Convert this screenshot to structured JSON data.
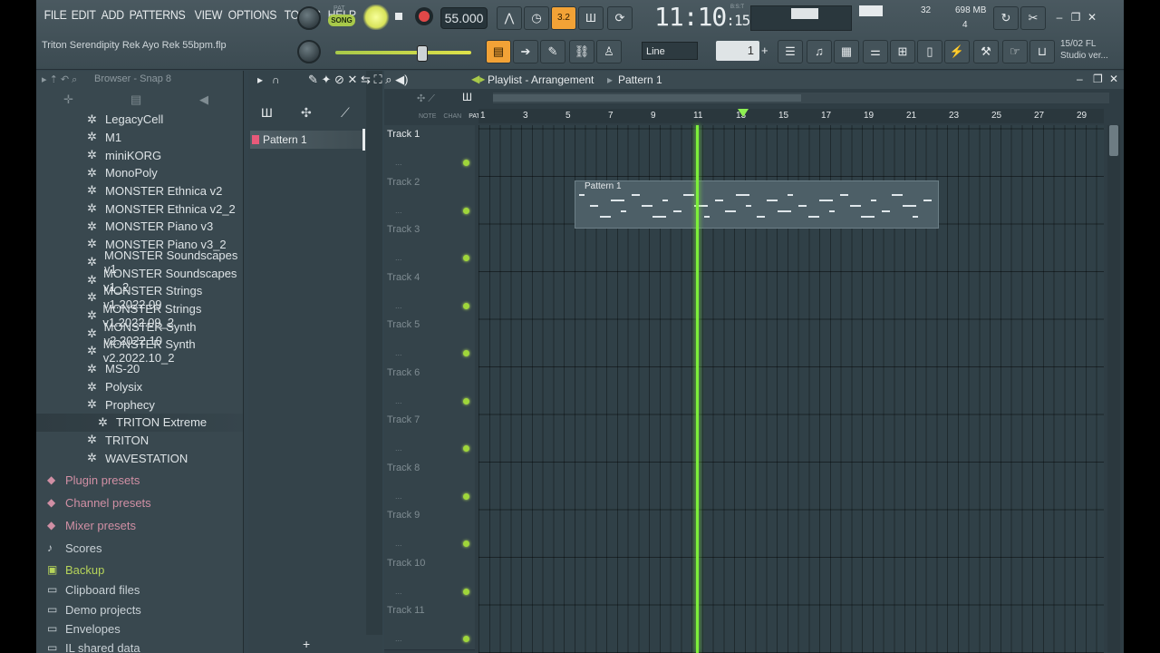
{
  "menu": [
    "FILE",
    "EDIT",
    "ADD",
    "PATTERNS",
    "VIEW",
    "OPTIONS",
    "TOOLS",
    "HELP"
  ],
  "project_name": "Triton Serendipity Rek Ayo Rek 55bpm.flp",
  "transport": {
    "pat_label": "PAT",
    "song_label": "SONG",
    "tempo": "55.000",
    "time_main": "11:10",
    "time_ticks": "15",
    "bst_label": "B:S:T",
    "pattern_step": "3.2"
  },
  "cpu": {
    "value": "32",
    "memory": "698 MB",
    "voices": "4"
  },
  "snap": {
    "mode": "Line",
    "step": "1"
  },
  "news": {
    "date": "15/02",
    "line1": "FL",
    "line2": "Studio ver..."
  },
  "browser": {
    "title": "Browser - Snap 8",
    "items": [
      "LegacyCell",
      "M1",
      "miniKORG",
      "MonoPoly",
      "MONSTER Ethnica v2",
      "MONSTER Ethnica v2_2",
      "MONSTER Piano v3",
      "MONSTER Piano v3_2",
      "MONSTER Soundscapes v1",
      "MONSTER Soundscapes v1_2",
      "MONSTER Strings v1.2022.09",
      "MONSTER Strings v1.2022.09_2",
      "MONSTER Synth v2.2022.10",
      "MONSTER Synth v2.2022.10_2",
      "MS-20",
      "Polysix",
      "Prophecy",
      "TRITON Extreme",
      "TRITON",
      "WAVESTATION"
    ],
    "selected": "TRITON Extreme",
    "categories": [
      "Plugin presets",
      "Channel presets",
      "Mixer presets",
      "Scores",
      "Backup",
      "Clipboard files",
      "Demo projects",
      "Envelopes",
      "IL shared data"
    ]
  },
  "patterns": {
    "items": [
      "Pattern 1"
    ],
    "add_label": "+"
  },
  "playlist": {
    "breadcrumb": [
      "Playlist - Arrangement",
      "Pattern 1"
    ],
    "ruler": [
      "1",
      "3",
      "5",
      "7",
      "9",
      "11",
      "13",
      "15",
      "17",
      "19",
      "21",
      "23",
      "25",
      "27",
      "29"
    ],
    "tracks": [
      "Track 1",
      "Track 2",
      "Track 3",
      "Track 4",
      "Track 5",
      "Track 6",
      "Track 7",
      "Track 8",
      "Track 9",
      "Track 10",
      "Track 11"
    ],
    "header_labels": [
      "NOTE",
      "CHAN",
      "PAT"
    ],
    "clip_label": "Pattern 1",
    "playhead_bar": 11.2
  },
  "colors": {
    "accent": "#f2a236",
    "song": "#a8c94a",
    "playhead": "#7ef03a",
    "pattern": "#e85a7a"
  }
}
